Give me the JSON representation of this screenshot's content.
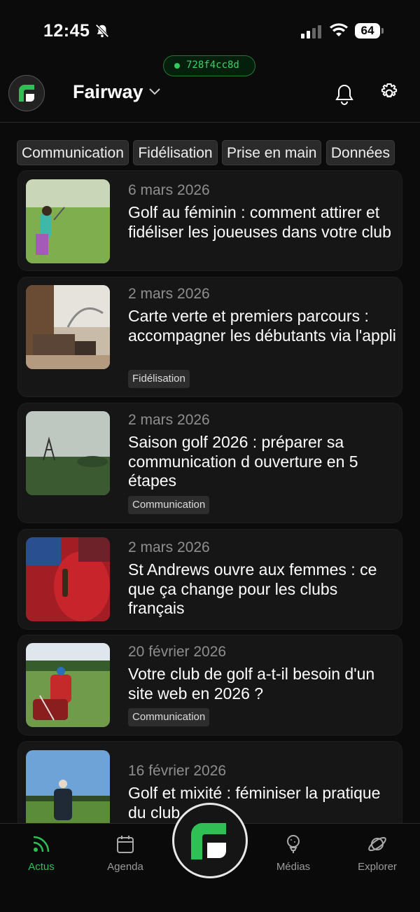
{
  "status_bar": {
    "time": "12:45",
    "battery": "64"
  },
  "commit": {
    "hash": "728f4cc8d",
    "color": "#2fcc5b"
  },
  "header": {
    "brand": "Fairway",
    "accent": "#2fbf55"
  },
  "chips": [
    "Communication",
    "Fidélisation",
    "Prise en main",
    "Données"
  ],
  "articles": [
    {
      "date": "6 mars 2026",
      "title": "Golf au féminin : comment attirer et fidéliser les joueuses dans votre club",
      "tag": ""
    },
    {
      "date": "2 mars 2026",
      "title": "Carte verte et premiers parcours : accompagner les débutants via l'appli",
      "tag": "Fidélisation"
    },
    {
      "date": "2 mars 2026",
      "title": "Saison golf 2026 : préparer sa communication d ouverture en 5 étapes",
      "tag": "Communication"
    },
    {
      "date": "2 mars 2026",
      "title": "St Andrews ouvre aux femmes : ce que ça change pour les clubs français",
      "tag": ""
    },
    {
      "date": "20 février 2026",
      "title": "Votre club de golf a-t-il besoin d'un site web en 2026 ?",
      "tag": "Communication"
    },
    {
      "date": "16 février 2026",
      "title": "Golf et mixité : féminiser la pratique du club",
      "tag": ""
    }
  ],
  "nav": {
    "items": [
      {
        "label": "Actus",
        "icon": "rss-icon",
        "active": true
      },
      {
        "label": "Agenda",
        "icon": "calendar-icon",
        "active": false
      },
      {
        "label": "Médias",
        "icon": "golf-tee-icon",
        "active": false
      },
      {
        "label": "Explorer",
        "icon": "planet-icon",
        "active": false
      }
    ]
  }
}
